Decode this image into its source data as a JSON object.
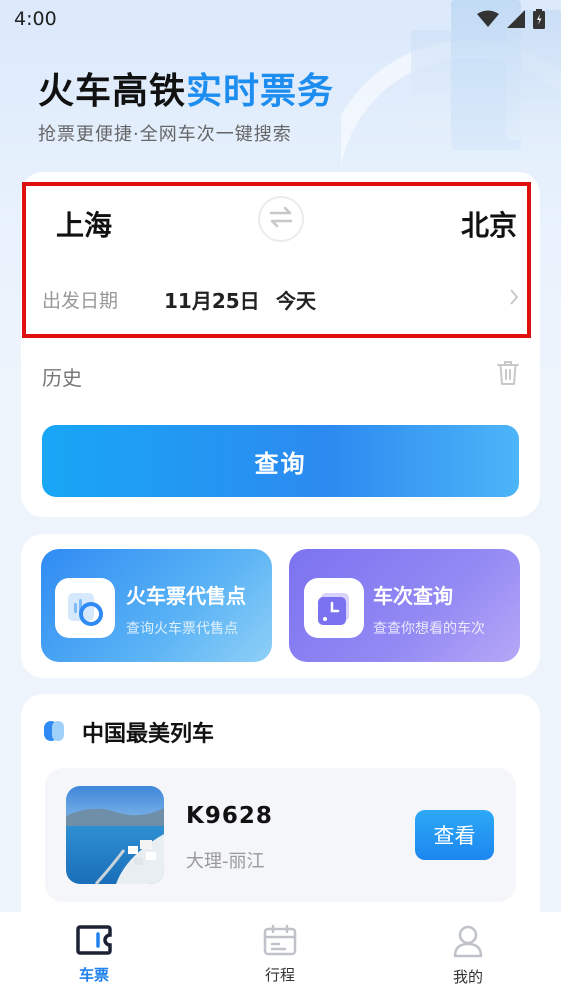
{
  "status": {
    "time": "4:00"
  },
  "hero": {
    "title_main": "火车高铁",
    "title_accent": "实时票务",
    "subtitle": "抢票更便捷·全网车次一键搜索"
  },
  "search": {
    "from_city": "上海",
    "to_city": "北京",
    "date_label": "出发日期",
    "date_value": "11月25日",
    "date_relative": "今天",
    "history_label": "历史",
    "search_button": "查询"
  },
  "tiles": [
    {
      "title": "火车票代售点",
      "desc": "查询火车票代售点",
      "icon": "ticket-agent-icon"
    },
    {
      "title": "车次查询",
      "desc": "查查你想看的车次",
      "icon": "train-schedule-icon"
    }
  ],
  "beauty": {
    "section_title": "中国最美列车",
    "trains": [
      {
        "number": "K9628",
        "route": "大理-丽江",
        "button": "查看"
      }
    ]
  },
  "tabbar": {
    "items": [
      {
        "label": "车票",
        "icon": "ticket-icon",
        "active": true
      },
      {
        "label": "行程",
        "icon": "calendar-icon",
        "active": false
      },
      {
        "label": "我的",
        "icon": "user-icon",
        "active": false
      }
    ]
  },
  "colors": {
    "accent": "#1d8df0",
    "highlight_box": "#e01010",
    "tile_blue": "#2f8bf3",
    "tile_purple": "#7b72f0"
  }
}
